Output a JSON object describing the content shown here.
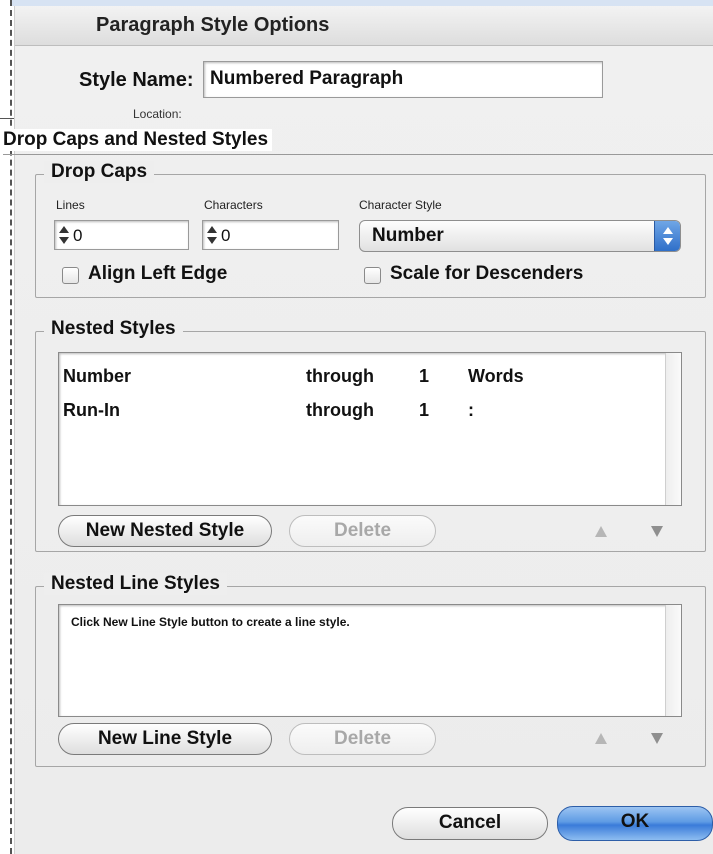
{
  "dialog": {
    "title": "Paragraph Style Options",
    "style_name_label": "Style Name:",
    "style_name_value": "Numbered Paragraph",
    "location_label": "Location:",
    "section_title": "Drop Caps and Nested Styles"
  },
  "drop_caps": {
    "legend": "Drop Caps",
    "lines_label": "Lines",
    "lines_value": "0",
    "characters_label": "Characters",
    "characters_value": "0",
    "character_style_label": "Character Style",
    "character_style_value": "Number",
    "align_left_edge_label": "Align Left Edge",
    "align_left_edge_checked": false,
    "scale_descenders_label": "Scale for Descenders",
    "scale_descenders_checked": false
  },
  "nested_styles": {
    "legend": "Nested Styles",
    "rows": [
      {
        "style": "Number",
        "mode": "through",
        "count": "1",
        "unit": "Words"
      },
      {
        "style": "Run-In",
        "mode": "through",
        "count": "1",
        "unit": ":"
      }
    ],
    "new_button": "New Nested Style",
    "delete_button": "Delete",
    "up_icon": "up-arrow-icon",
    "down_icon": "down-arrow-icon"
  },
  "nested_line_styles": {
    "legend": "Nested Line Styles",
    "hint": "Click New Line Style button to create a line style.",
    "new_button": "New Line Style",
    "delete_button": "Delete"
  },
  "footer": {
    "cancel_button": "Cancel",
    "ok_button": "OK"
  },
  "colors": {
    "accent": "#3a7bd9",
    "dialog_bg": "#ececec"
  }
}
